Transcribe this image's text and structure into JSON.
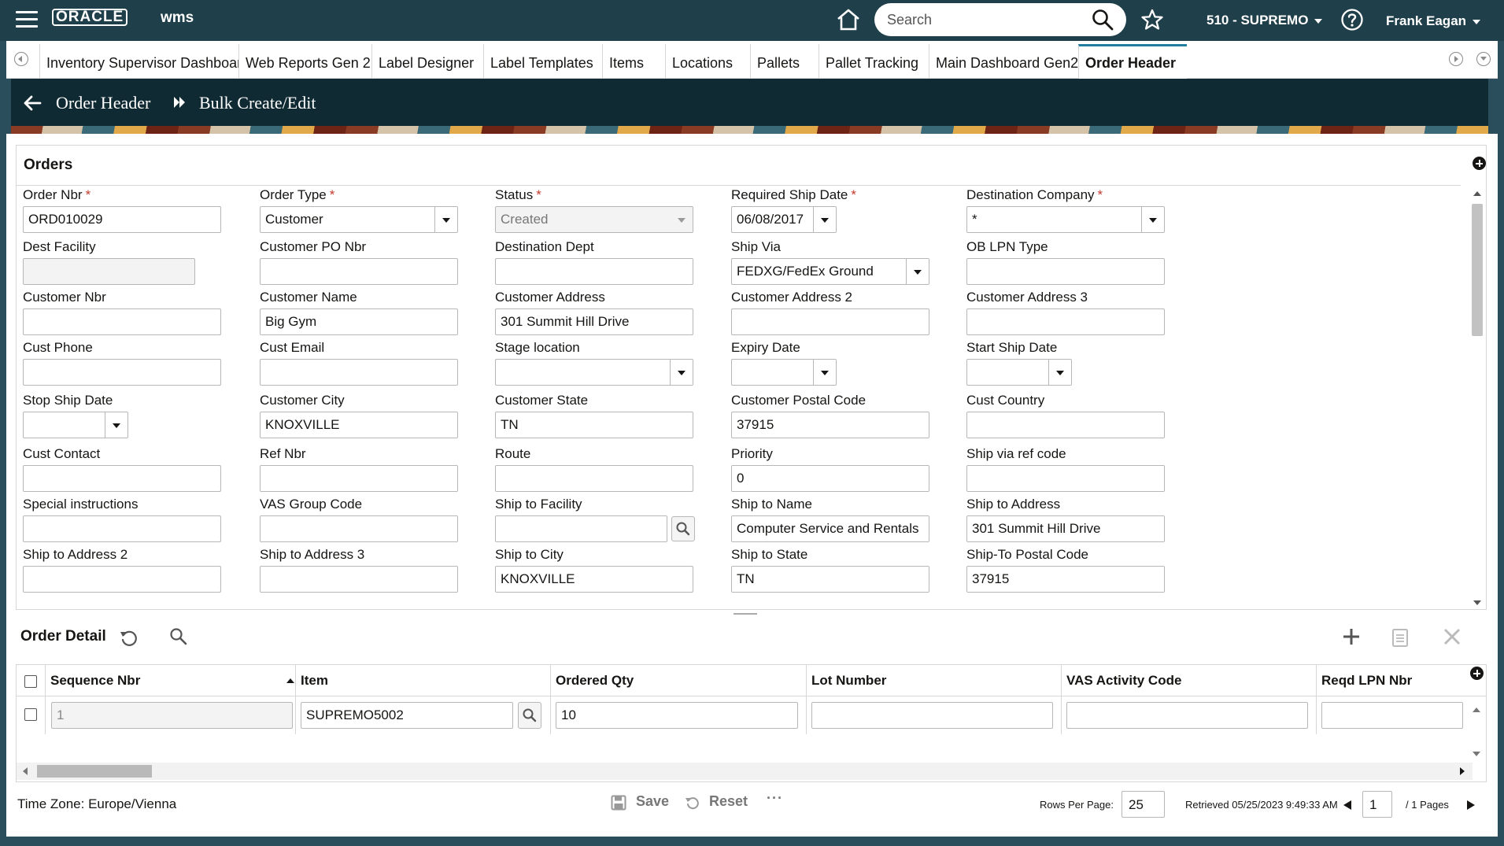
{
  "header": {
    "logo": "ORACLE",
    "product": "wms",
    "search_placeholder": "Search",
    "facility": "510 - SUPREMO",
    "user": "Frank Eagan"
  },
  "tabs": [
    {
      "label": "Inventory Supervisor Dashboard",
      "active": false
    },
    {
      "label": "Web Reports Gen 2",
      "active": false
    },
    {
      "label": "Label Designer",
      "active": false
    },
    {
      "label": "Label Templates",
      "active": false
    },
    {
      "label": "Items",
      "active": false
    },
    {
      "label": "Locations",
      "active": false
    },
    {
      "label": "Pallets",
      "active": false
    },
    {
      "label": "Pallet Tracking",
      "active": false
    },
    {
      "label": "Main Dashboard Gen2",
      "active": false
    },
    {
      "label": "Order Header",
      "active": true
    }
  ],
  "breadcrumb": {
    "parent": "Order Header",
    "current": "Bulk Create/Edit"
  },
  "orders": {
    "title": "Orders",
    "fields": {
      "order_nbr": {
        "label": "Order Nbr",
        "value": "ORD010029"
      },
      "order_type": {
        "label": "Order Type",
        "value": "Customer"
      },
      "status": {
        "label": "Status",
        "value": "Created"
      },
      "required_ship_date": {
        "label": "Required Ship Date",
        "value": "06/08/2017"
      },
      "destination_company": {
        "label": "Destination Company",
        "value": "*"
      },
      "dest_facility": {
        "label": "Dest Facility",
        "value": ""
      },
      "customer_po_nbr": {
        "label": "Customer PO Nbr",
        "value": ""
      },
      "destination_dept": {
        "label": "Destination Dept",
        "value": ""
      },
      "ship_via": {
        "label": "Ship Via",
        "value": "FEDXG/FedEx Ground"
      },
      "ob_lpn_type": {
        "label": "OB LPN Type",
        "value": ""
      },
      "customer_nbr": {
        "label": "Customer Nbr",
        "value": ""
      },
      "customer_name": {
        "label": "Customer Name",
        "value": "Big Gym"
      },
      "customer_address": {
        "label": "Customer Address",
        "value": "301 Summit Hill Drive"
      },
      "customer_address_2": {
        "label": "Customer Address 2",
        "value": ""
      },
      "customer_address_3": {
        "label": "Customer Address 3",
        "value": ""
      },
      "cust_phone": {
        "label": "Cust Phone",
        "value": ""
      },
      "cust_email": {
        "label": "Cust Email",
        "value": ""
      },
      "stage_location": {
        "label": "Stage location",
        "value": ""
      },
      "expiry_date": {
        "label": "Expiry Date",
        "value": ""
      },
      "start_ship_date": {
        "label": "Start Ship Date",
        "value": ""
      },
      "stop_ship_date": {
        "label": "Stop Ship Date",
        "value": ""
      },
      "customer_city": {
        "label": "Customer City",
        "value": "KNOXVILLE"
      },
      "customer_state": {
        "label": "Customer State",
        "value": "TN"
      },
      "customer_postal_code": {
        "label": "Customer Postal Code",
        "value": "37915"
      },
      "cust_country": {
        "label": "Cust Country",
        "value": ""
      },
      "cust_contact": {
        "label": "Cust Contact",
        "value": ""
      },
      "ref_nbr": {
        "label": "Ref Nbr",
        "value": ""
      },
      "route": {
        "label": "Route",
        "value": ""
      },
      "priority": {
        "label": "Priority",
        "value": "0"
      },
      "ship_via_ref_code": {
        "label": "Ship via ref code",
        "value": ""
      },
      "special_instructions": {
        "label": "Special instructions",
        "value": ""
      },
      "vas_group_code": {
        "label": "VAS Group Code",
        "value": ""
      },
      "ship_to_facility": {
        "label": "Ship to Facility",
        "value": ""
      },
      "ship_to_name": {
        "label": "Ship to Name",
        "value": "Computer Service and Rentals"
      },
      "ship_to_address": {
        "label": "Ship to Address",
        "value": "301 Summit Hill Drive"
      },
      "ship_to_address_2": {
        "label": "Ship to Address 2",
        "value": ""
      },
      "ship_to_address_3": {
        "label": "Ship to Address 3",
        "value": ""
      },
      "ship_to_city": {
        "label": "Ship to City",
        "value": "KNOXVILLE"
      },
      "ship_to_state": {
        "label": "Ship to State",
        "value": "TN"
      },
      "ship_to_postal_code": {
        "label": "Ship-To Postal Code",
        "value": "37915"
      }
    }
  },
  "detail": {
    "title": "Order Detail",
    "columns": [
      "Sequence Nbr",
      "Item",
      "Ordered Qty",
      "Lot Number",
      "VAS Activity Code",
      "Reqd LPN Nbr"
    ],
    "rows": [
      {
        "sequence_nbr": "1",
        "item": "SUPREMO5002",
        "ordered_qty": "10",
        "lot_number": "",
        "vas_activity_code": "",
        "reqd_lpn_nbr": ""
      }
    ]
  },
  "footer": {
    "time_zone": "Time Zone: Europe/Vienna",
    "save": "Save",
    "reset": "Reset",
    "more": "···",
    "rows_per_page_label": "Rows Per Page:",
    "rows_per_page": "25",
    "retrieved": "Retrieved 05/25/2023 9:49:33 AM",
    "page": "1",
    "pages_total": "/ 1 Pages"
  },
  "colors": {
    "topbar": "#1f3f4a",
    "page_header": "#102a33",
    "active_tab_accent": "#227e9e",
    "required_marker": "#c43a2b"
  }
}
